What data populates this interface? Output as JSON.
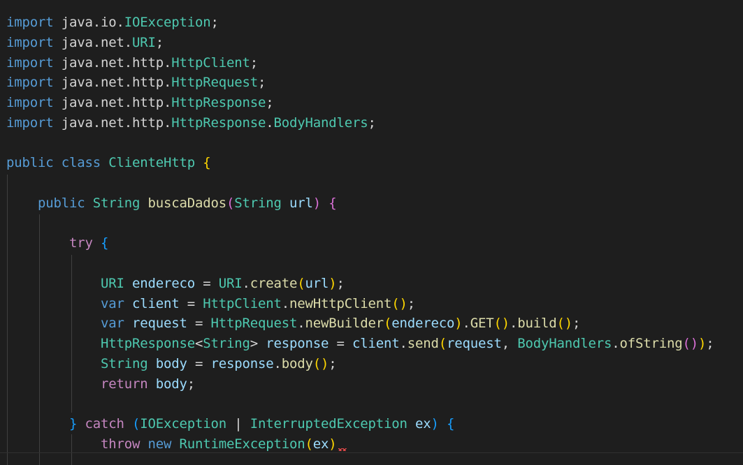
{
  "editor": {
    "theme": {
      "background": "#1e1e1e",
      "keyword": "#569cd6",
      "control": "#c586c0",
      "type": "#4ec9b0",
      "variable": "#9cdcfe",
      "function": "#dcdcaa",
      "punctuation": "#d4d4d4",
      "bracket1": "#ffd700",
      "bracket2": "#da70d6",
      "bracket3": "#179fff",
      "error": "#f14c4c"
    },
    "lines": [
      [
        {
          "t": "import",
          "c": "keyword"
        },
        {
          "t": " java.io.",
          "c": "punctuation"
        },
        {
          "t": "IOException",
          "c": "type"
        },
        {
          "t": ";",
          "c": "punctuation"
        }
      ],
      [
        {
          "t": "import",
          "c": "keyword"
        },
        {
          "t": " java.net.",
          "c": "punctuation"
        },
        {
          "t": "URI",
          "c": "type"
        },
        {
          "t": ";",
          "c": "punctuation"
        }
      ],
      [
        {
          "t": "import",
          "c": "keyword"
        },
        {
          "t": " java.net.http.",
          "c": "punctuation"
        },
        {
          "t": "HttpClient",
          "c": "type"
        },
        {
          "t": ";",
          "c": "punctuation"
        }
      ],
      [
        {
          "t": "import",
          "c": "keyword"
        },
        {
          "t": " java.net.http.",
          "c": "punctuation"
        },
        {
          "t": "HttpRequest",
          "c": "type"
        },
        {
          "t": ";",
          "c": "punctuation"
        }
      ],
      [
        {
          "t": "import",
          "c": "keyword"
        },
        {
          "t": " java.net.http.",
          "c": "punctuation"
        },
        {
          "t": "HttpResponse",
          "c": "type"
        },
        {
          "t": ";",
          "c": "punctuation"
        }
      ],
      [
        {
          "t": "import",
          "c": "keyword"
        },
        {
          "t": " java.net.http.",
          "c": "punctuation"
        },
        {
          "t": "HttpResponse",
          "c": "type"
        },
        {
          "t": ".",
          "c": "punctuation"
        },
        {
          "t": "BodyHandlers",
          "c": "type"
        },
        {
          "t": ";",
          "c": "punctuation"
        }
      ],
      [],
      [
        {
          "t": "public",
          "c": "keyword"
        },
        {
          "t": " ",
          "c": "punctuation"
        },
        {
          "t": "class",
          "c": "keyword"
        },
        {
          "t": " ",
          "c": "punctuation"
        },
        {
          "t": "ClienteHttp",
          "c": "type"
        },
        {
          "t": " ",
          "c": "punctuation"
        },
        {
          "t": "{",
          "c": "bracket1"
        }
      ],
      [],
      [
        {
          "t": "    ",
          "c": "punctuation"
        },
        {
          "t": "public",
          "c": "keyword"
        },
        {
          "t": " ",
          "c": "punctuation"
        },
        {
          "t": "String",
          "c": "type"
        },
        {
          "t": " ",
          "c": "punctuation"
        },
        {
          "t": "buscaDados",
          "c": "function"
        },
        {
          "t": "(",
          "c": "bracket2"
        },
        {
          "t": "String",
          "c": "type"
        },
        {
          "t": " ",
          "c": "punctuation"
        },
        {
          "t": "url",
          "c": "variable"
        },
        {
          "t": ")",
          "c": "bracket2"
        },
        {
          "t": " ",
          "c": "punctuation"
        },
        {
          "t": "{",
          "c": "bracket2"
        }
      ],
      [],
      [
        {
          "t": "        ",
          "c": "punctuation"
        },
        {
          "t": "try",
          "c": "control"
        },
        {
          "t": " ",
          "c": "punctuation"
        },
        {
          "t": "{",
          "c": "bracket3"
        }
      ],
      [],
      [
        {
          "t": "            ",
          "c": "punctuation"
        },
        {
          "t": "URI",
          "c": "type"
        },
        {
          "t": " ",
          "c": "punctuation"
        },
        {
          "t": "endereco",
          "c": "variable"
        },
        {
          "t": " = ",
          "c": "punctuation"
        },
        {
          "t": "URI",
          "c": "type"
        },
        {
          "t": ".",
          "c": "punctuation"
        },
        {
          "t": "create",
          "c": "function"
        },
        {
          "t": "(",
          "c": "bracket1"
        },
        {
          "t": "url",
          "c": "variable"
        },
        {
          "t": ")",
          "c": "bracket1"
        },
        {
          "t": ";",
          "c": "punctuation"
        }
      ],
      [
        {
          "t": "            ",
          "c": "punctuation"
        },
        {
          "t": "var",
          "c": "keyword"
        },
        {
          "t": " ",
          "c": "punctuation"
        },
        {
          "t": "client",
          "c": "variable"
        },
        {
          "t": " = ",
          "c": "punctuation"
        },
        {
          "t": "HttpClient",
          "c": "type"
        },
        {
          "t": ".",
          "c": "punctuation"
        },
        {
          "t": "newHttpClient",
          "c": "function"
        },
        {
          "t": "()",
          "c": "bracket1"
        },
        {
          "t": ";",
          "c": "punctuation"
        }
      ],
      [
        {
          "t": "            ",
          "c": "punctuation"
        },
        {
          "t": "var",
          "c": "keyword"
        },
        {
          "t": " ",
          "c": "punctuation"
        },
        {
          "t": "request",
          "c": "variable"
        },
        {
          "t": " = ",
          "c": "punctuation"
        },
        {
          "t": "HttpRequest",
          "c": "type"
        },
        {
          "t": ".",
          "c": "punctuation"
        },
        {
          "t": "newBuilder",
          "c": "function"
        },
        {
          "t": "(",
          "c": "bracket1"
        },
        {
          "t": "endereco",
          "c": "variable"
        },
        {
          "t": ")",
          "c": "bracket1"
        },
        {
          "t": ".",
          "c": "punctuation"
        },
        {
          "t": "GET",
          "c": "function"
        },
        {
          "t": "()",
          "c": "bracket1"
        },
        {
          "t": ".",
          "c": "punctuation"
        },
        {
          "t": "build",
          "c": "function"
        },
        {
          "t": "()",
          "c": "bracket1"
        },
        {
          "t": ";",
          "c": "punctuation"
        }
      ],
      [
        {
          "t": "            ",
          "c": "punctuation"
        },
        {
          "t": "HttpResponse",
          "c": "type"
        },
        {
          "t": "<",
          "c": "punctuation"
        },
        {
          "t": "String",
          "c": "type"
        },
        {
          "t": "> ",
          "c": "punctuation"
        },
        {
          "t": "response",
          "c": "variable"
        },
        {
          "t": " = ",
          "c": "punctuation"
        },
        {
          "t": "client",
          "c": "variable"
        },
        {
          "t": ".",
          "c": "punctuation"
        },
        {
          "t": "send",
          "c": "function"
        },
        {
          "t": "(",
          "c": "bracket1"
        },
        {
          "t": "request",
          "c": "variable"
        },
        {
          "t": ", ",
          "c": "punctuation"
        },
        {
          "t": "BodyHandlers",
          "c": "type"
        },
        {
          "t": ".",
          "c": "punctuation"
        },
        {
          "t": "ofString",
          "c": "function"
        },
        {
          "t": "()",
          "c": "bracket2"
        },
        {
          "t": ")",
          "c": "bracket1"
        },
        {
          "t": ";",
          "c": "punctuation"
        }
      ],
      [
        {
          "t": "            ",
          "c": "punctuation"
        },
        {
          "t": "String",
          "c": "type"
        },
        {
          "t": " ",
          "c": "punctuation"
        },
        {
          "t": "body",
          "c": "variable"
        },
        {
          "t": " = ",
          "c": "punctuation"
        },
        {
          "t": "response",
          "c": "variable"
        },
        {
          "t": ".",
          "c": "punctuation"
        },
        {
          "t": "body",
          "c": "function"
        },
        {
          "t": "()",
          "c": "bracket1"
        },
        {
          "t": ";",
          "c": "punctuation"
        }
      ],
      [
        {
          "t": "            ",
          "c": "punctuation"
        },
        {
          "t": "return",
          "c": "control"
        },
        {
          "t": " ",
          "c": "punctuation"
        },
        {
          "t": "body",
          "c": "variable"
        },
        {
          "t": ";",
          "c": "punctuation"
        }
      ],
      [],
      [
        {
          "t": "        ",
          "c": "punctuation"
        },
        {
          "t": "}",
          "c": "bracket3"
        },
        {
          "t": " ",
          "c": "punctuation"
        },
        {
          "t": "catch",
          "c": "control"
        },
        {
          "t": " ",
          "c": "punctuation"
        },
        {
          "t": "(",
          "c": "bracket3"
        },
        {
          "t": "IOException",
          "c": "type"
        },
        {
          "t": " | ",
          "c": "punctuation"
        },
        {
          "t": "InterruptedException",
          "c": "type"
        },
        {
          "t": " ",
          "c": "punctuation"
        },
        {
          "t": "ex",
          "c": "variable"
        },
        {
          "t": ")",
          "c": "bracket3"
        },
        {
          "t": " ",
          "c": "punctuation"
        },
        {
          "t": "{",
          "c": "bracket3"
        }
      ],
      [
        {
          "t": "            ",
          "c": "punctuation"
        },
        {
          "t": "throw",
          "c": "control"
        },
        {
          "t": " ",
          "c": "punctuation"
        },
        {
          "t": "new",
          "c": "keyword"
        },
        {
          "t": " ",
          "c": "punctuation"
        },
        {
          "t": "RuntimeException",
          "c": "type"
        },
        {
          "t": "(",
          "c": "bracket1"
        },
        {
          "t": "ex",
          "c": "variable"
        },
        {
          "t": ")",
          "c": "bracket1"
        }
      ]
    ]
  }
}
